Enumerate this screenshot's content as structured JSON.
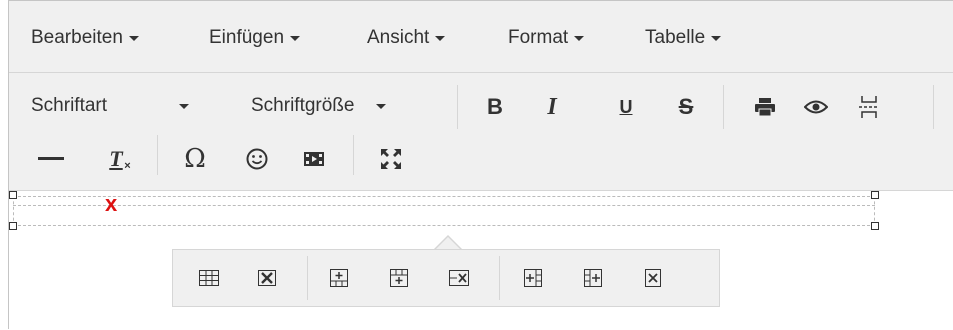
{
  "menubar": {
    "items": [
      {
        "label": "Bearbeiten"
      },
      {
        "label": "Einfügen"
      },
      {
        "label": "Ansicht"
      },
      {
        "label": "Format"
      },
      {
        "label": "Tabelle"
      }
    ]
  },
  "toolbar": {
    "font_select": "Schriftart",
    "size_select": "Schriftgröße",
    "bold": "B",
    "italic": "I",
    "underline": "U",
    "strike": "S",
    "remove_format": "T",
    "special_char": "Ω",
    "emoji": "☺"
  },
  "content": {
    "cell_text": "x"
  },
  "icons": {
    "print": "print-icon",
    "preview": "eye-icon",
    "pagebreak": "page-break-icon",
    "hr": "horizontal-line-icon",
    "media": "media-icon",
    "fullscreen": "fullscreen-icon"
  },
  "colors": {
    "toolbar_bg": "#f0f0f0",
    "accent_x": "#dd1111"
  }
}
